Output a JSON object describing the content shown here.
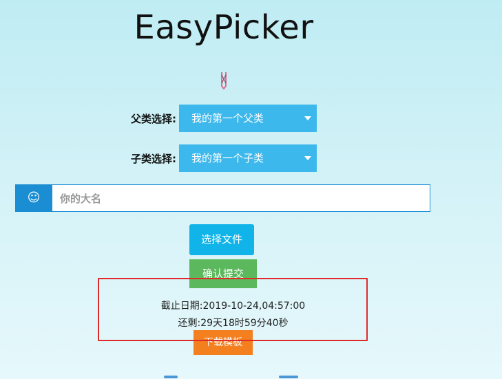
{
  "app": {
    "title": "EasyPicker"
  },
  "form": {
    "parent_label": "父类选择:",
    "parent_value": "我的第一个父类",
    "child_label": "子类选择:",
    "child_value": "我的第一个子类",
    "name_placeholder": "你的大名",
    "name_addon_icon": "smiley-icon"
  },
  "buttons": {
    "choose_file": "选择文件",
    "submit": "确认提交",
    "download_template": "下载模板"
  },
  "deadline": {
    "date_text": "截止日期:2019-10-24,04:57:00",
    "remaining_text": "还剩:29天18时59分40秒"
  },
  "colors": {
    "select_bg": "#3db8ec",
    "addon_bg": "#1b8ed3",
    "choose_bg": "#11b4e8",
    "submit_bg": "#5cb85c",
    "download_bg": "#f37f1e",
    "highlight": "#e02a2a"
  }
}
